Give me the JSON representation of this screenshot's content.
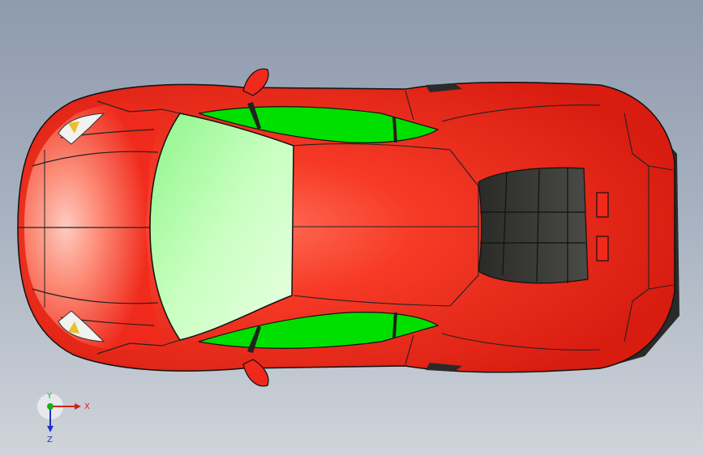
{
  "viewport": {
    "model": "car-body-top-view"
  },
  "triad": {
    "x_label": "X",
    "y_label": "Y",
    "z_label": "Z",
    "x_color": "#d42020",
    "y_color": "#18b018",
    "z_color": "#2030c8"
  },
  "colors": {
    "body": "#f0291c",
    "body_highlight": "#ffd8cc",
    "glass_rear": "#00e000",
    "windshield": "#d8ffd0",
    "vent": "#3a3a38",
    "background_top": "#8e9aae",
    "background_bottom": "#d0d4da"
  }
}
